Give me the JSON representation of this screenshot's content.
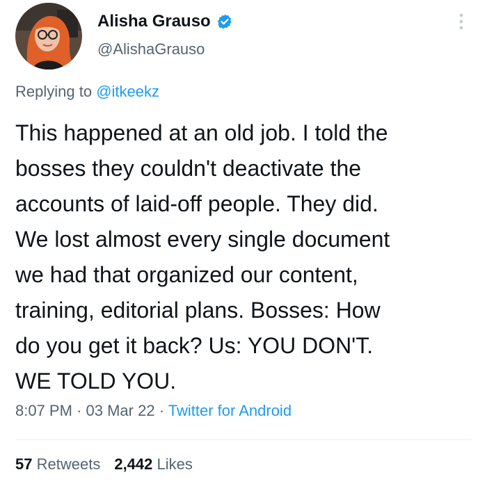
{
  "author": {
    "display_name": "Alisha Grauso",
    "handle": "@AlishaGrauso",
    "verified": true,
    "avatar_icon": "avatar-photo"
  },
  "reply": {
    "prefix": "Replying to",
    "mention": "@itkeekz"
  },
  "tweet": {
    "text": "This happened at an old job. I told the\nbosses they couldn't deactivate the\naccounts of laid-off people. They did.\nWe lost almost every single document\nwe had that organized our content,\ntraining, editorial plans. Bosses: How\ndo you get it back? Us: YOU DON'T.\nWE TOLD YOU."
  },
  "meta": {
    "time": "8:07 PM",
    "separator": "·",
    "date": "03 Mar 22",
    "source": "Twitter for Android"
  },
  "stats": {
    "retweets_count": "57",
    "retweets_label": "Retweets",
    "likes_count": "2,442",
    "likes_label": "Likes"
  },
  "colors": {
    "accent": "#1d9bf0",
    "text": "#0f1419",
    "secondary": "#536471"
  },
  "icons": {
    "verified": "verified-badge-icon",
    "more": "more-options-icon"
  }
}
